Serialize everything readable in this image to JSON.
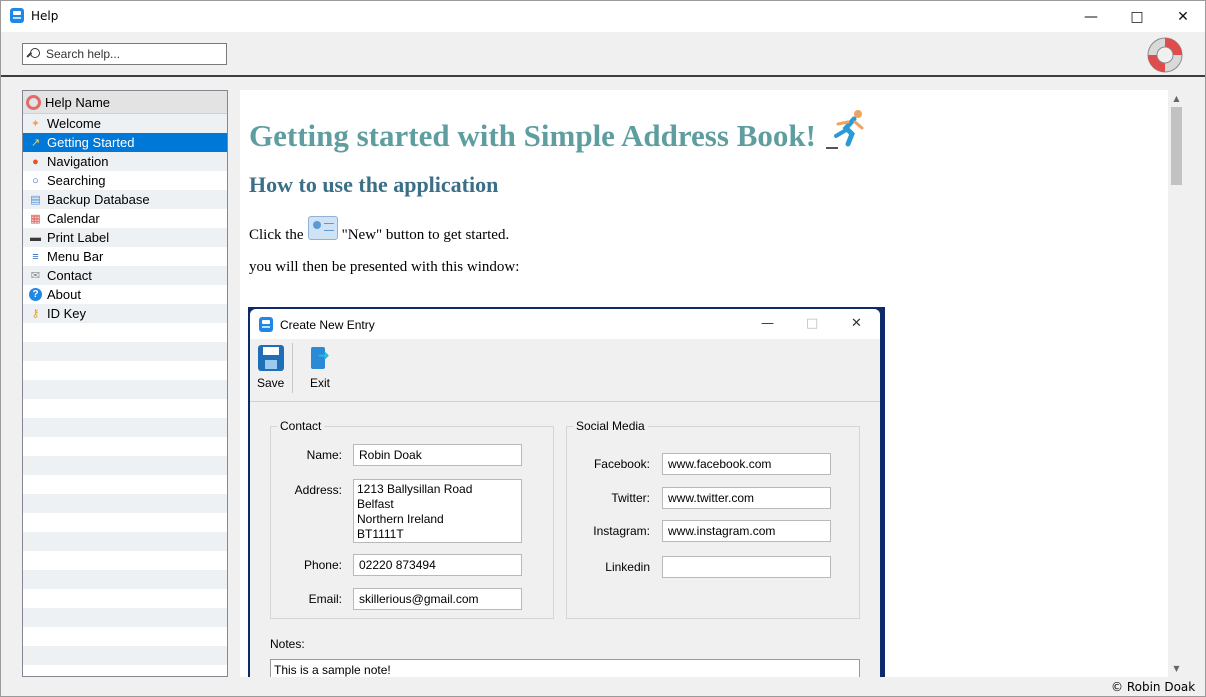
{
  "window": {
    "title": "Help"
  },
  "search": {
    "placeholder": "Search help..."
  },
  "sidebar": {
    "header": "Help Name",
    "items": [
      {
        "label": "Welcome",
        "icon": "handshake-icon"
      },
      {
        "label": "Getting Started",
        "icon": "runner-icon",
        "selected": true
      },
      {
        "label": "Navigation",
        "icon": "map-pin-icon"
      },
      {
        "label": "Searching",
        "icon": "search-icon"
      },
      {
        "label": "Backup Database",
        "icon": "database-icon"
      },
      {
        "label": "Calendar",
        "icon": "calendar-icon"
      },
      {
        "label": "Print Label",
        "icon": "printer-icon"
      },
      {
        "label": "Menu Bar",
        "icon": "menu-icon"
      },
      {
        "label": "Contact",
        "icon": "envelope-icon"
      },
      {
        "label": "About",
        "icon": "question-icon"
      },
      {
        "label": "ID Key",
        "icon": "key-icon"
      }
    ]
  },
  "content": {
    "heading": "Getting started with Simple Address Book!",
    "subheading": "How to use the application",
    "p1_before": "Click the",
    "p1_after": "\"New\" button to get started.",
    "p2": "you will then be presented with this window:",
    "screenshot": {
      "title": "Create New Entry",
      "toolbar": {
        "save": "Save",
        "exit": "Exit"
      },
      "contact": {
        "legend": "Contact",
        "name_label": "Name:",
        "name": "Robin Doak",
        "address_label": "Address:",
        "address": "1213 Ballysillan Road\nBelfast\nNorthern Ireland\nBT1111T",
        "phone_label": "Phone:",
        "phone": "02220 873494",
        "email_label": "Email:",
        "email": "skillerious@gmail.com"
      },
      "social": {
        "legend": "Social Media",
        "facebook_label": "Facebook:",
        "facebook": "www.facebook.com",
        "twitter_label": "Twitter:",
        "twitter": "www.twitter.com",
        "instagram_label": "Instagram:",
        "instagram": "www.instagram.com",
        "linkedin_label": "Linkedin",
        "linkedin": ""
      },
      "notes_label": "Notes:",
      "notes": "This is a sample note!"
    }
  },
  "status": {
    "copyright": "© Robin Doak"
  },
  "colors": {
    "accent": "#0078d7",
    "heading": "#5f9ea0",
    "subheading": "#3a6f87"
  }
}
